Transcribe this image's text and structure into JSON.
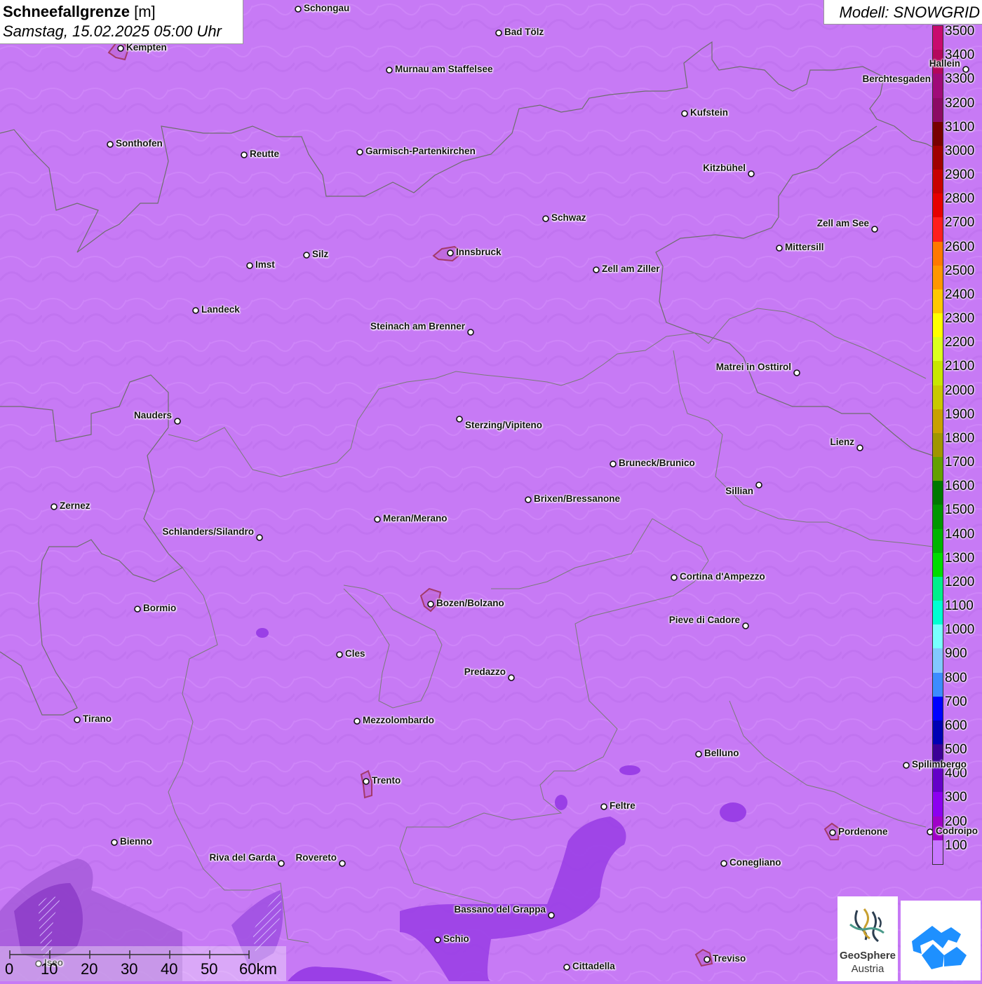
{
  "header": {
    "title": "Schneefallgrenze",
    "unit": "[m]",
    "datetime": "Samstag, 15.02.2025 05:00 Uhr"
  },
  "model_label": "Modell: SNOWGRID",
  "legend": {
    "levels": [
      {
        "value": "3500",
        "color": "#c80a6e"
      },
      {
        "value": "3400",
        "color": "#b4075c"
      },
      {
        "value": "3300",
        "color": "#a00a78"
      },
      {
        "value": "3200",
        "color": "#8c0a64"
      },
      {
        "value": "3100",
        "color": "#780000"
      },
      {
        "value": "3000",
        "color": "#a00000"
      },
      {
        "value": "2900",
        "color": "#c80000"
      },
      {
        "value": "2800",
        "color": "#e60000"
      },
      {
        "value": "2700",
        "color": "#ff1e1e"
      },
      {
        "value": "2600",
        "color": "#ff7800"
      },
      {
        "value": "2500",
        "color": "#ff9600"
      },
      {
        "value": "2400",
        "color": "#ffc800"
      },
      {
        "value": "2300",
        "color": "#ffff00"
      },
      {
        "value": "2200",
        "color": "#dcff1e"
      },
      {
        "value": "2100",
        "color": "#c8e600"
      },
      {
        "value": "2000",
        "color": "#c8c800"
      },
      {
        "value": "1900",
        "color": "#c8a000"
      },
      {
        "value": "1800",
        "color": "#a09600"
      },
      {
        "value": "1700",
        "color": "#64a000"
      },
      {
        "value": "1600",
        "color": "#007800"
      },
      {
        "value": "1500",
        "color": "#009600"
      },
      {
        "value": "1400",
        "color": "#00b400"
      },
      {
        "value": "1300",
        "color": "#00dc00"
      },
      {
        "value": "1200",
        "color": "#00f08c"
      },
      {
        "value": "1100",
        "color": "#00ffd2"
      },
      {
        "value": "1000",
        "color": "#78ffff"
      },
      {
        "value": "900",
        "color": "#82c8ff"
      },
      {
        "value": "800",
        "color": "#3c8cff"
      },
      {
        "value": "700",
        "color": "#0000ff"
      },
      {
        "value": "600",
        "color": "#0000b4"
      },
      {
        "value": "500",
        "color": "#3c0096"
      },
      {
        "value": "400",
        "color": "#6400c8"
      },
      {
        "value": "300",
        "color": "#8c00f0"
      },
      {
        "value": "200",
        "color": "#a000c8"
      },
      {
        "value": "100",
        "color": "#c878ff"
      }
    ]
  },
  "cities": [
    {
      "name": "Schongau"
    },
    {
      "name": "Bad Tölz"
    },
    {
      "name": "Kempten"
    },
    {
      "name": "Murnau am Staffelsee"
    },
    {
      "name": "Hallein"
    },
    {
      "name": "Berchtesgaden"
    },
    {
      "name": "Kufstein"
    },
    {
      "name": "Sonthofen"
    },
    {
      "name": "Reutte"
    },
    {
      "name": "Garmisch-Partenkirchen"
    },
    {
      "name": "Kitzbühel"
    },
    {
      "name": "Schwaz"
    },
    {
      "name": "Zell am See"
    },
    {
      "name": "Innsbruck"
    },
    {
      "name": "Mittersill"
    },
    {
      "name": "Imst"
    },
    {
      "name": "Silz"
    },
    {
      "name": "Zell am Ziller"
    },
    {
      "name": "Landeck"
    },
    {
      "name": "Steinach am Brenner"
    },
    {
      "name": "Matrei in Osttirol"
    },
    {
      "name": "Nauders"
    },
    {
      "name": "Sterzing/Vipiteno"
    },
    {
      "name": "Lienz"
    },
    {
      "name": "Bruneck/Brunico"
    },
    {
      "name": "Sillian"
    },
    {
      "name": "Zernez"
    },
    {
      "name": "Brixen/Bressanone"
    },
    {
      "name": "Meran/Merano"
    },
    {
      "name": "Schlanders/Silandro"
    },
    {
      "name": "Cortina d'Ampezzo"
    },
    {
      "name": "Bozen/Bolzano"
    },
    {
      "name": "Bormio"
    },
    {
      "name": "Pieve di Cadore"
    },
    {
      "name": "Cles"
    },
    {
      "name": "Predazzo"
    },
    {
      "name": "Tirano"
    },
    {
      "name": "Mezzolombardo"
    },
    {
      "name": "Belluno"
    },
    {
      "name": "Spilimbergo"
    },
    {
      "name": "Trento"
    },
    {
      "name": "Feltre"
    },
    {
      "name": "Pordenone"
    },
    {
      "name": "Codroipo"
    },
    {
      "name": "Bienno"
    },
    {
      "name": "Riva del Garda"
    },
    {
      "name": "Rovereto"
    },
    {
      "name": "Conegliano"
    },
    {
      "name": "Bassano del Grappa"
    },
    {
      "name": "Schio"
    },
    {
      "name": "Iseo"
    },
    {
      "name": "Cittadella"
    },
    {
      "name": "Treviso"
    }
  ],
  "scale": {
    "labels": [
      "0",
      "10",
      "20",
      "30",
      "40",
      "50",
      "60km"
    ]
  },
  "logos": {
    "geosphere_line1": "GeoSphere",
    "geosphere_line2": "Austria"
  }
}
